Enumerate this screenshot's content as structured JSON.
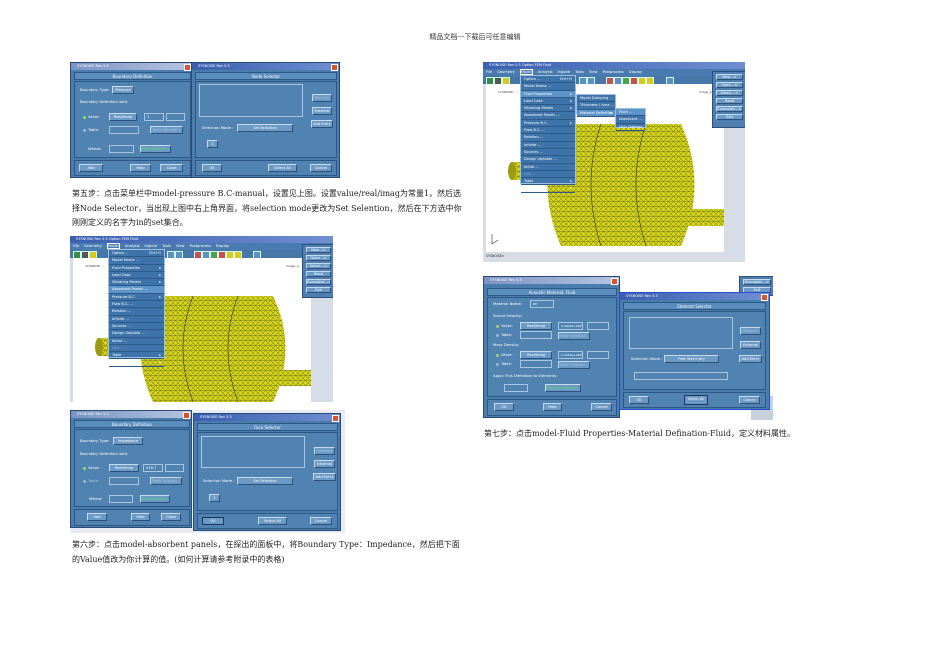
{
  "header": "精品文档---下载后可任意编辑",
  "dialog_title": "SYSNOISE Rev 5.5",
  "main_window_title": "SYSNOISE Rev 5.5 Option FEM Fluid",
  "menubar": [
    "File",
    "Geometry",
    "Model",
    "Analysis",
    "Inquire",
    "Tools",
    "View",
    "Postprocess",
    "Display"
  ],
  "model_menu": [
    {
      "label": "Option ...",
      "accel": "Ctrl+O"
    },
    {
      "label": "Model Name ..."
    },
    {
      "label": "Fluid Properties",
      "submenu": true
    },
    {
      "label": "Load Case",
      "submenu": true
    },
    {
      "label": "Vibrating Panels",
      "submenu": true
    },
    {
      "label": "Absorbent Panels ..."
    },
    {
      "label": "Pressure B.C.",
      "submenu": true
    },
    {
      "label": "Flow B.C. ..."
    },
    {
      "label": "Relation ..."
    },
    {
      "label": "Infinite ..."
    },
    {
      "label": "Sources ..."
    },
    {
      "label": "Design Variable ..."
    },
    {
      "label": "Initial ..."
    },
    {
      "label": "Link ..."
    },
    {
      "label": "Table",
      "submenu": true
    },
    {
      "label": "Reset",
      "submenu": true
    }
  ],
  "fluid_submenu": [
    "Modal Damping ...",
    "Thickness / Area ...",
    "Material Definition"
  ],
  "material_submenu": [
    "Fluid ...",
    "Absorbent ...",
    "User Defined ..."
  ],
  "side_panel": [
    "New -->",
    "Open -->",
    "Select -->",
    "Read",
    "Examples -->",
    "Exit"
  ],
  "canvas_label_left": "SYSNOISE - ...",
  "canvas_label_right": "image_p...",
  "command_prompt": "SYSNOISE>",
  "shot1": {
    "boundary": {
      "heading": "Boundary Definition",
      "type_label": "Boundary Type:",
      "type_value": "Pressure",
      "def_with": "Boundary Definition with:",
      "value_label": "Value:",
      "value_mode": "Real/Imag",
      "value_real": "1",
      "table_label": "Table:",
      "table_selector": "Table Selector...",
      "where_label": "Where:",
      "selector_button": "Node Selector...",
      "add": "Add",
      "help": "Help",
      "close": "Close"
    },
    "selector": {
      "heading": "Node Selector",
      "remove": "Remove",
      "external": "External",
      "add_entry": "Add Entry",
      "mode_label": "Selection Mode :",
      "mode_value": "Set Selection",
      "set_value": "1",
      "ok": "OK",
      "select_all": "Select All",
      "cancel": "Cancel"
    }
  },
  "step5_text": "第五步：点击菜单栏中model-pressure B.C-manual，设置见上图。设置value/real/imag为常量1，然后选择Node Selector，当出现上图中右上角界面，将selection mode更改为Set Selention，然后在下方选中你刚刚定义的名字为in的set集合。",
  "shot3": {
    "boundary": {
      "heading": "Boundary Definition",
      "type_label": "Boundary Type:",
      "type_value": "Impedance",
      "def_with": "Boundary Definition with:",
      "value_label": "Value:",
      "value_mode": "Real/Imag",
      "value_real": "416.7",
      "table_label": "Table:",
      "table_selector": "Table Selector...",
      "where_label": "Where:",
      "selector_button": "Face Selector...",
      "add": "Add",
      "help": "Help",
      "close": "Close"
    },
    "selector": {
      "heading": "Face Selector",
      "remove": "Remove",
      "external": "External",
      "add_entry": "Add Entry",
      "mode_label": "Selection Mode :",
      "mode_value": "Set Selection",
      "set_value": "2",
      "ok": "OK",
      "select_all": "Select All",
      "cancel": "Cancel"
    }
  },
  "step6_text": "第六步：点击model-absorbent panels，在探出的面板中，将Boundary Type：Impedance，然后把下面的Value值改为你计算的值。(如何计算请参考附录中的表格)",
  "shot5": {
    "material": {
      "heading": "Acoustic Material: Fluid",
      "name_label": "Material Name:",
      "name_value": "air",
      "velocity_label": "Sound Velocity:",
      "density_label": "Mass Density:",
      "value_label": "Value:",
      "table_label": "Table:",
      "mode": "Real/Imag",
      "velocity_value": "3.4000e+002",
      "density_value": "1.2250e+000",
      "table_selector": "Table Selector...",
      "apply_label": "Apply This Definition to Elements:",
      "element_selector": "Element Selector...",
      "ok": "OK",
      "help": "Help",
      "cancel": "Cancel"
    },
    "selector": {
      "heading": "Element Selector",
      "remove": "Remove",
      "external": "External",
      "add_entry": "Add Entry",
      "mode_label": "Selection Mode :",
      "mode_value": "Free Text Entry",
      "ok": "OK",
      "select_all": "Select All",
      "cancel": "Cancel"
    },
    "bg_buttons": [
      "Examples -->",
      "Exit"
    ]
  },
  "step7_text": "第七步：点击model-Fluid Properties-Material Defination-Fluid，定义材料属性。",
  "colors": {
    "dialog_bg": "#4b7dac",
    "mesh_yellow": "#d6d41c",
    "selector_green": "#55e05a"
  }
}
